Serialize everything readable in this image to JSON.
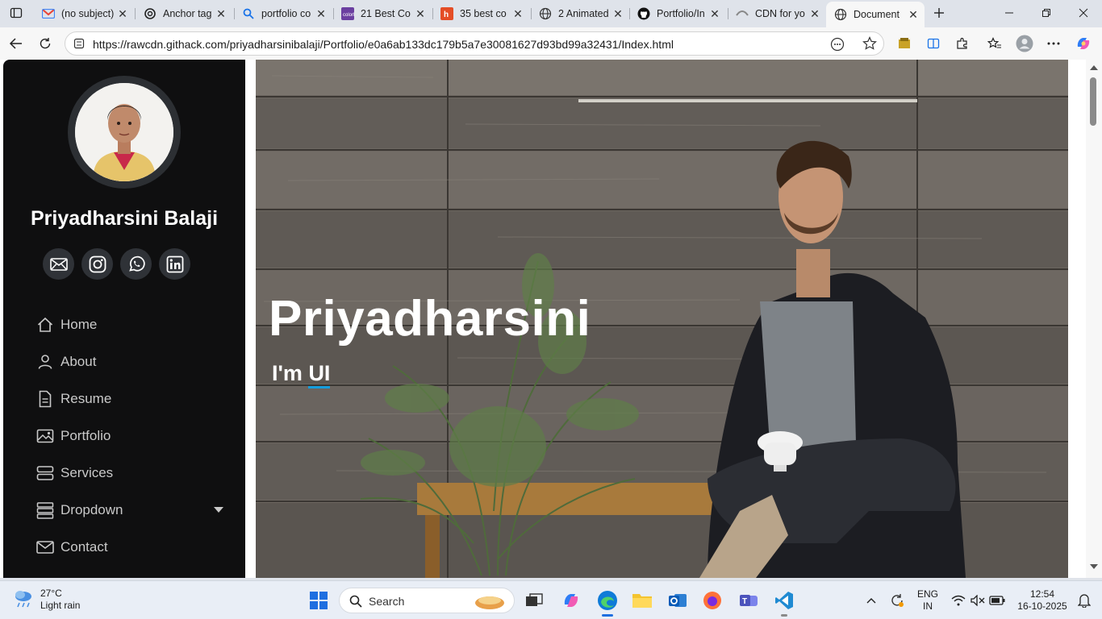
{
  "browser": {
    "tabs": [
      {
        "title": "(no subject)",
        "icon": "gmail-icon"
      },
      {
        "title": "Anchor tag",
        "icon": "chatgpt-icon"
      },
      {
        "title": "portfolio co",
        "icon": "search-icon"
      },
      {
        "title": "21 Best Co",
        "icon": "colorlib-icon"
      },
      {
        "title": "35 best co",
        "icon": "html5-icon"
      },
      {
        "title": "2 Animated",
        "icon": "globe-icon"
      },
      {
        "title": "Portfolio/In",
        "icon": "github-icon"
      },
      {
        "title": "CDN for yo",
        "icon": "cdn-icon"
      },
      {
        "title": "Document",
        "icon": "globe-icon",
        "active": true
      }
    ],
    "url": "https://rawcdn.githack.com/priyadharsinibalaji/Portfolio/e0a6ab133dc179b5a7e30081627d93bd99a32431/Index.html"
  },
  "sidebar": {
    "name": "Priyadharsini Balaji",
    "socials": [
      {
        "icon": "envelope-icon"
      },
      {
        "icon": "instagram-icon"
      },
      {
        "icon": "whatsapp-icon"
      },
      {
        "icon": "linkedin-icon"
      }
    ],
    "nav": [
      {
        "label": "Home",
        "icon": "house-icon"
      },
      {
        "label": "About",
        "icon": "person-icon"
      },
      {
        "label": "Resume",
        "icon": "file-icon"
      },
      {
        "label": "Portfolio",
        "icon": "images-icon"
      },
      {
        "label": "Services",
        "icon": "server-icon"
      },
      {
        "label": "Dropdown",
        "icon": "menu-icon"
      },
      {
        "label": "Contact",
        "icon": "envelope-icon"
      }
    ]
  },
  "hero": {
    "title": "Priyadharsini",
    "sub_prefix": "I'm ",
    "sub_typed": "UI"
  },
  "taskbar": {
    "temperature": "27°C",
    "weather": "Light rain",
    "search_label": "Search",
    "lang_top": "ENG",
    "lang_bottom": "IN",
    "time": "12:54",
    "date": "16-10-2025"
  },
  "colors": {
    "accent": "#149ddd",
    "sidebar_bg": "#0f0f10",
    "social_bg": "#2f3237"
  }
}
